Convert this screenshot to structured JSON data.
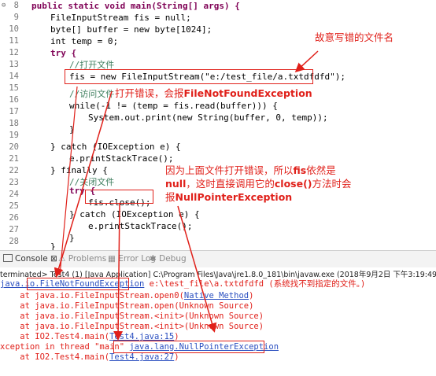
{
  "editor": {
    "line_numbers": [
      "8",
      "9",
      "10",
      "11",
      "12",
      "13",
      "14",
      "15",
      "16",
      "17",
      "18",
      "19",
      "20",
      "21",
      "22",
      "23",
      "24",
      "25",
      "26",
      "27",
      "28",
      "29",
      "30",
      "31"
    ],
    "lines": {
      "l8": "public static void main(String[] args) {",
      "l9": "FileInputStream fis = null;",
      "l10": "byte[] buffer = new byte[1024];",
      "l11": "int temp = 0;",
      "l13": "try {",
      "l14": "//打开文件",
      "l15": "fis = new FileInputStream(\"e:/test_file/a.txtdfdfd\");",
      "l17": "//访问文件",
      "l18": "while(-1 != (temp = fis.read(buffer))) {",
      "l19": "System.out.print(new String(buffer, 0, temp));",
      "l20": "}",
      "l22": "} catch (IOException e) {",
      "l23": "e.printStackTrace();",
      "l24": "} finally {",
      "l25": "//关闭文件",
      "l26": "try {",
      "l27": "fis.close();",
      "l28": "} catch (IOException e) {",
      "l29": "e.printStackTrace();",
      "l30": "}",
      "l31": "}"
    }
  },
  "annotations": {
    "wrong_filename": "故意写错的文件名",
    "file_error_prefix": "打开错误，会报",
    "file_error_exc": "FileNotFoundException",
    "null_line1_a": "因为上面文件打开错误，所以",
    "null_line1_b": "fis",
    "null_line1_c": "依然是",
    "null_line2_a": "null",
    "null_line2_b": "，这时直接调用它的",
    "null_line2_c": "close()",
    "null_line2_d": "方法时会",
    "null_line3_a": "报",
    "null_line3_b": "NullPointerException"
  },
  "console": {
    "tabs": [
      {
        "label": "Console",
        "close": "⊠"
      },
      {
        "label": "Problems"
      },
      {
        "label": "Error Log"
      },
      {
        "label": "Debug"
      }
    ],
    "terminated": "terminated> Test4 (1) [Java Application] C:\\Program Files\\Java\\jre1.8.0_181\\bin\\javaw.exe (2018年9月2日 下午3:19:49)",
    "lines": {
      "c1_pkg": "java.io.",
      "c1_exc": "FileNotFoundException",
      "c1_msg": " e:\\test_file\\a.txtdfdfd (系统找不到指定的文件。)",
      "c2_a": "    at java.io.FileInputStream.open0(",
      "c2_link": "Native Method",
      "c2_b": ")",
      "c3": "    at java.io.FileInputStream.open(Unknown Source)",
      "c4": "    at java.io.FileInputStream.<init>(Unknown Source)",
      "c5": "    at java.io.FileInputStream.<init>(Unknown Source)",
      "c6_a": "    at IO2.Test4.main(",
      "c6_link": "Test4.java:15",
      "c6_b": ")",
      "c7_a": "xception in thread \"main\" ",
      "c7_exc": "java.lang.NullPointerException",
      "c8_a": "    at IO2.Test4.main(",
      "c8_link": "Test4.java:27",
      "c8_b": ")"
    }
  },
  "colors": {
    "annotation_red": "#e0201a",
    "keyword": "#7f0055",
    "comment": "#3f7f5f",
    "string": "#2a00ff",
    "link": "#2a4fc0"
  }
}
